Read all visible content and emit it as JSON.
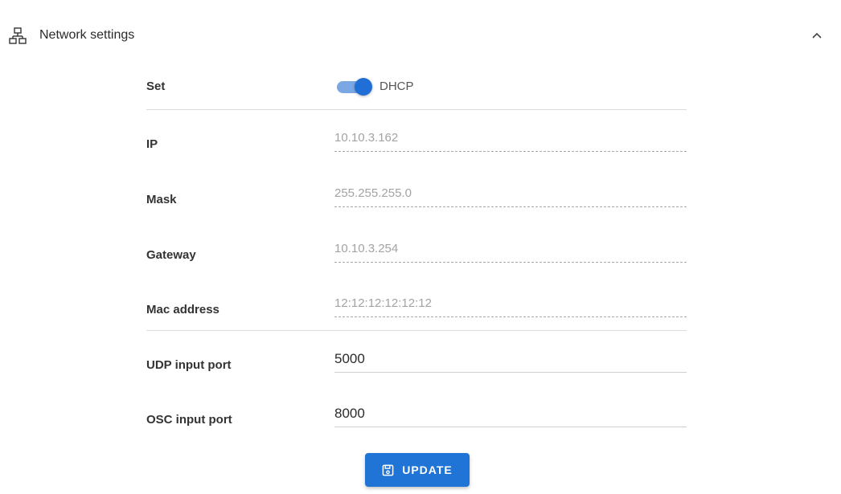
{
  "header": {
    "title": "Network settings",
    "icon": "network-icon",
    "collapse_icon": "chevron-up-icon"
  },
  "set_row": {
    "label": "Set",
    "toggle_label": "DHCP",
    "toggle_on": true
  },
  "fields": {
    "ip": {
      "label": "IP",
      "value": "10.10.3.162"
    },
    "mask": {
      "label": "Mask",
      "value": "255.255.255.0"
    },
    "gateway": {
      "label": "Gateway",
      "value": "10.10.3.254"
    },
    "mac": {
      "label": "Mac address",
      "value": "12:12:12:12:12:12"
    },
    "udp": {
      "label": "UDP input port",
      "value": "5000"
    },
    "osc": {
      "label": "OSC input port",
      "value": "8000"
    }
  },
  "update_button": {
    "label": "UPDATE",
    "icon": "save-icon"
  },
  "colors": {
    "accent": "#1f74d6",
    "toggle_track": "#7ba8e4",
    "disabled_text": "#a3a3a3"
  }
}
